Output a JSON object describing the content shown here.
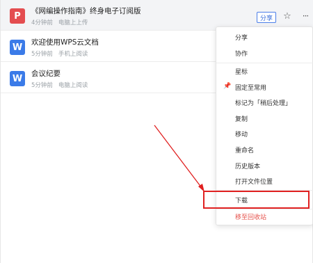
{
  "files": [
    {
      "name": "《网编操作指南》终身电子订阅版",
      "time": "4分钟前",
      "action": "电脑上上传",
      "type": "pdf",
      "icon": "pdf-icon",
      "icon_glyph": "P"
    },
    {
      "name": "欢迎使用WPS云文档",
      "time": "5分钟前",
      "action": "手机上阅读",
      "type": "wps",
      "icon": "wps-writer-icon",
      "icon_glyph": "W"
    },
    {
      "name": "会议纪要",
      "time": "5分钟前",
      "action": "电脑上阅读",
      "type": "wps",
      "icon": "wps-writer-icon",
      "icon_glyph": "W"
    }
  ],
  "row_actions": {
    "share_label": "分享",
    "star_icon": "star-icon",
    "more_icon": "more-icon",
    "star_glyph": "☆",
    "more_glyph": "···"
  },
  "menu": {
    "group1": [
      "分享",
      "协作"
    ],
    "group2": [
      "星标",
      "固定至常用",
      "标记为「稍后处理」",
      "复制",
      "移动",
      "重命名",
      "历史版本",
      "打开文件位置"
    ],
    "download": "下载",
    "delete": "移至回收站",
    "pin_glyph": "📌"
  },
  "colors": {
    "accent": "#3b6fd9",
    "danger": "#e5504a",
    "highlight": "#e02020",
    "pdf": "#e44d50",
    "wps": "#3b7be8"
  }
}
